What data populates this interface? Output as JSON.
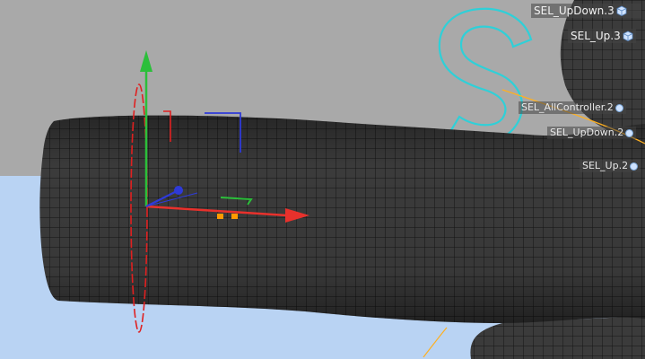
{
  "viewport": {
    "background_top": "#a9a9a9",
    "background_bottom": "#b9d3f3",
    "mesh_color": "#3a3a3a",
    "wire_color": "#151515"
  },
  "gizmo": {
    "x_axis_color": "#e8312c",
    "y_axis_color": "#2bbf3a",
    "z_axis_color": "#2e3ad8",
    "rotate_ring_color": "#e02020",
    "handle_color": "#ff9a00"
  },
  "labels": {
    "sel_updown_3": "SEL_UpDown.3",
    "sel_up_3": "SEL_Up.3",
    "sel_all_controller_2": "SEL_AllController.2",
    "sel_updown_2": "SEL_UpDown.2",
    "sel_up_2": "SEL_Up.2"
  },
  "icons": {
    "cube": "cube-icon",
    "null": "null-object-icon"
  },
  "curve_letter": "S",
  "curve_color": "#2fd0d8",
  "spline_color": "#ffb020"
}
